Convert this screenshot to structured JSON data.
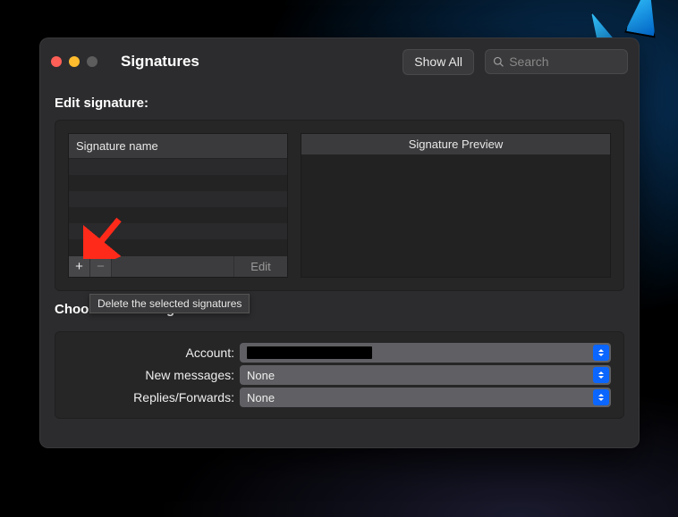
{
  "window": {
    "title": "Signatures",
    "showAll": "Show All",
    "searchPlaceholder": "Search"
  },
  "editSection": {
    "label": "Edit signature:",
    "listHeader": "Signature name",
    "previewHeader": "Signature Preview",
    "addTooltip": "Delete the selected signatures",
    "editButton": "Edit",
    "icons": {
      "add": "+",
      "remove": "−"
    }
  },
  "defaultSection": {
    "label": "Choose default signature:",
    "rows": {
      "account": {
        "label": "Account:",
        "value": ""
      },
      "newMessages": {
        "label": "New messages:",
        "value": "None"
      },
      "replies": {
        "label": "Replies/Forwards:",
        "value": "None"
      }
    }
  }
}
